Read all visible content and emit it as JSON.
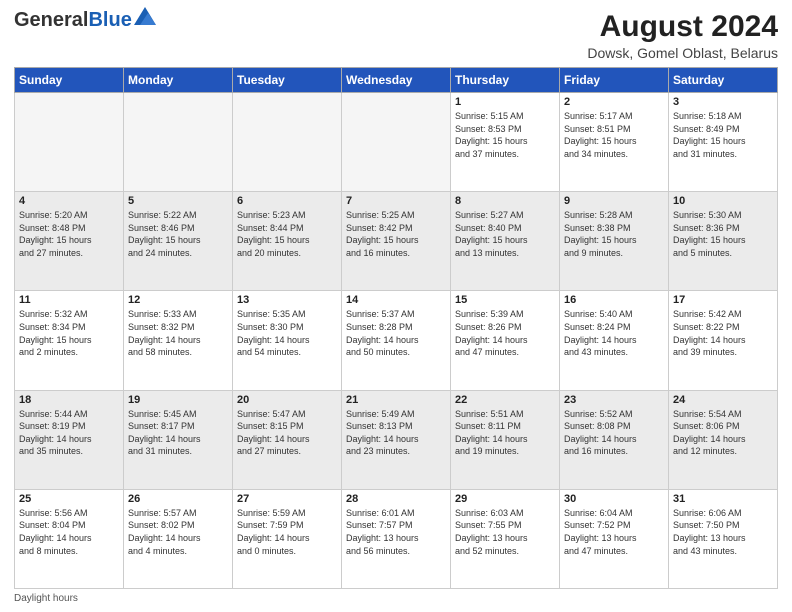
{
  "header": {
    "logo_general": "General",
    "logo_blue": "Blue",
    "month_year": "August 2024",
    "location": "Dowsk, Gomel Oblast, Belarus"
  },
  "days_of_week": [
    "Sunday",
    "Monday",
    "Tuesday",
    "Wednesday",
    "Thursday",
    "Friday",
    "Saturday"
  ],
  "footer": {
    "daylight_label": "Daylight hours"
  },
  "weeks": [
    [
      {
        "day": "",
        "info": ""
      },
      {
        "day": "",
        "info": ""
      },
      {
        "day": "",
        "info": ""
      },
      {
        "day": "",
        "info": ""
      },
      {
        "day": "1",
        "info": "Sunrise: 5:15 AM\nSunset: 8:53 PM\nDaylight: 15 hours\nand 37 minutes."
      },
      {
        "day": "2",
        "info": "Sunrise: 5:17 AM\nSunset: 8:51 PM\nDaylight: 15 hours\nand 34 minutes."
      },
      {
        "day": "3",
        "info": "Sunrise: 5:18 AM\nSunset: 8:49 PM\nDaylight: 15 hours\nand 31 minutes."
      }
    ],
    [
      {
        "day": "4",
        "info": "Sunrise: 5:20 AM\nSunset: 8:48 PM\nDaylight: 15 hours\nand 27 minutes."
      },
      {
        "day": "5",
        "info": "Sunrise: 5:22 AM\nSunset: 8:46 PM\nDaylight: 15 hours\nand 24 minutes."
      },
      {
        "day": "6",
        "info": "Sunrise: 5:23 AM\nSunset: 8:44 PM\nDaylight: 15 hours\nand 20 minutes."
      },
      {
        "day": "7",
        "info": "Sunrise: 5:25 AM\nSunset: 8:42 PM\nDaylight: 15 hours\nand 16 minutes."
      },
      {
        "day": "8",
        "info": "Sunrise: 5:27 AM\nSunset: 8:40 PM\nDaylight: 15 hours\nand 13 minutes."
      },
      {
        "day": "9",
        "info": "Sunrise: 5:28 AM\nSunset: 8:38 PM\nDaylight: 15 hours\nand 9 minutes."
      },
      {
        "day": "10",
        "info": "Sunrise: 5:30 AM\nSunset: 8:36 PM\nDaylight: 15 hours\nand 5 minutes."
      }
    ],
    [
      {
        "day": "11",
        "info": "Sunrise: 5:32 AM\nSunset: 8:34 PM\nDaylight: 15 hours\nand 2 minutes."
      },
      {
        "day": "12",
        "info": "Sunrise: 5:33 AM\nSunset: 8:32 PM\nDaylight: 14 hours\nand 58 minutes."
      },
      {
        "day": "13",
        "info": "Sunrise: 5:35 AM\nSunset: 8:30 PM\nDaylight: 14 hours\nand 54 minutes."
      },
      {
        "day": "14",
        "info": "Sunrise: 5:37 AM\nSunset: 8:28 PM\nDaylight: 14 hours\nand 50 minutes."
      },
      {
        "day": "15",
        "info": "Sunrise: 5:39 AM\nSunset: 8:26 PM\nDaylight: 14 hours\nand 47 minutes."
      },
      {
        "day": "16",
        "info": "Sunrise: 5:40 AM\nSunset: 8:24 PM\nDaylight: 14 hours\nand 43 minutes."
      },
      {
        "day": "17",
        "info": "Sunrise: 5:42 AM\nSunset: 8:22 PM\nDaylight: 14 hours\nand 39 minutes."
      }
    ],
    [
      {
        "day": "18",
        "info": "Sunrise: 5:44 AM\nSunset: 8:19 PM\nDaylight: 14 hours\nand 35 minutes."
      },
      {
        "day": "19",
        "info": "Sunrise: 5:45 AM\nSunset: 8:17 PM\nDaylight: 14 hours\nand 31 minutes."
      },
      {
        "day": "20",
        "info": "Sunrise: 5:47 AM\nSunset: 8:15 PM\nDaylight: 14 hours\nand 27 minutes."
      },
      {
        "day": "21",
        "info": "Sunrise: 5:49 AM\nSunset: 8:13 PM\nDaylight: 14 hours\nand 23 minutes."
      },
      {
        "day": "22",
        "info": "Sunrise: 5:51 AM\nSunset: 8:11 PM\nDaylight: 14 hours\nand 19 minutes."
      },
      {
        "day": "23",
        "info": "Sunrise: 5:52 AM\nSunset: 8:08 PM\nDaylight: 14 hours\nand 16 minutes."
      },
      {
        "day": "24",
        "info": "Sunrise: 5:54 AM\nSunset: 8:06 PM\nDaylight: 14 hours\nand 12 minutes."
      }
    ],
    [
      {
        "day": "25",
        "info": "Sunrise: 5:56 AM\nSunset: 8:04 PM\nDaylight: 14 hours\nand 8 minutes."
      },
      {
        "day": "26",
        "info": "Sunrise: 5:57 AM\nSunset: 8:02 PM\nDaylight: 14 hours\nand 4 minutes."
      },
      {
        "day": "27",
        "info": "Sunrise: 5:59 AM\nSunset: 7:59 PM\nDaylight: 14 hours\nand 0 minutes."
      },
      {
        "day": "28",
        "info": "Sunrise: 6:01 AM\nSunset: 7:57 PM\nDaylight: 13 hours\nand 56 minutes."
      },
      {
        "day": "29",
        "info": "Sunrise: 6:03 AM\nSunset: 7:55 PM\nDaylight: 13 hours\nand 52 minutes."
      },
      {
        "day": "30",
        "info": "Sunrise: 6:04 AM\nSunset: 7:52 PM\nDaylight: 13 hours\nand 47 minutes."
      },
      {
        "day": "31",
        "info": "Sunrise: 6:06 AM\nSunset: 7:50 PM\nDaylight: 13 hours\nand 43 minutes."
      }
    ]
  ]
}
